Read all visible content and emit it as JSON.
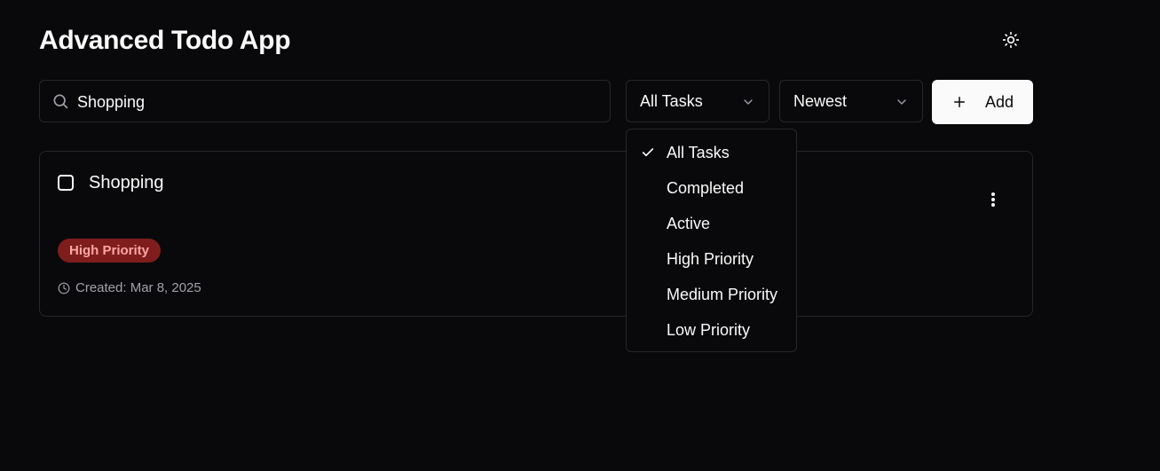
{
  "app": {
    "title": "Advanced Todo App"
  },
  "icons": {
    "theme": "sun-icon",
    "search": "search-icon",
    "chevron": "chevron-down-icon",
    "add": "plus-icon",
    "check": "check-icon",
    "menu": "more-vertical-icon",
    "clock": "clock-icon"
  },
  "search": {
    "value": "Shopping",
    "placeholder": ""
  },
  "filter": {
    "selected": "All Tasks"
  },
  "sort": {
    "selected": "Newest"
  },
  "add_button": {
    "label": "Add"
  },
  "dropdown": {
    "items": [
      {
        "label": "All Tasks",
        "selected": true
      },
      {
        "label": "Completed",
        "selected": false
      },
      {
        "label": "Active",
        "selected": false
      },
      {
        "label": "High Priority",
        "selected": false
      },
      {
        "label": "Medium Priority",
        "selected": false
      },
      {
        "label": "Low Priority",
        "selected": false
      }
    ]
  },
  "tasks": [
    {
      "title": "Shopping",
      "completed": false,
      "priority": "High Priority",
      "created": "Created: Mar 8, 2025"
    }
  ],
  "colors": {
    "background": "#09090b",
    "border": "#27272a",
    "priority_high_bg": "#7f1d1d",
    "priority_high_text": "#fca5a5",
    "muted_text": "#a1a1aa"
  }
}
